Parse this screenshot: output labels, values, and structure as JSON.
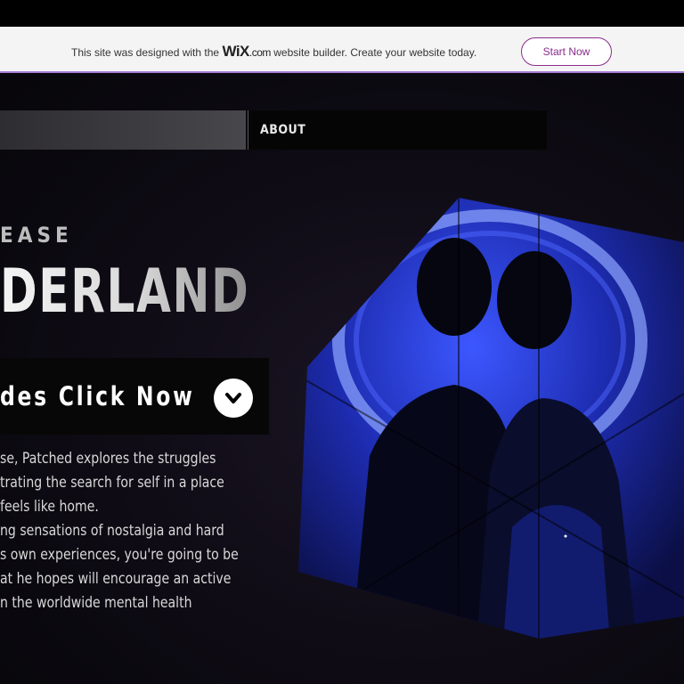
{
  "banner": {
    "text_before": "This site was designed with the",
    "logo_wix": "WiX",
    "logo_com": ".com",
    "text_after": "website builder. Create your website today.",
    "cta_label": "Start Now"
  },
  "nav": {
    "items": [
      {
        "label": ""
      },
      {
        "label": "ABOUT"
      }
    ]
  },
  "hero": {
    "kicker": "EASE",
    "title": "DERLAND",
    "cta_label": "des Click Now",
    "description_lines": [
      "se, Patched explores the struggles",
      "trating the search for self in a place",
      "feels like home.",
      "ng sensations of nostalgia and hard",
      "s own experiences, you're going to be",
      "at he hopes will encourage an active",
      "n the worldwide mental health"
    ]
  },
  "colors": {
    "banner_accent": "#8b2c8c",
    "art_blue": "#2b3fd8",
    "background": "#0e0b14"
  },
  "icons": {
    "cta": "chevron-down-circle-icon"
  }
}
